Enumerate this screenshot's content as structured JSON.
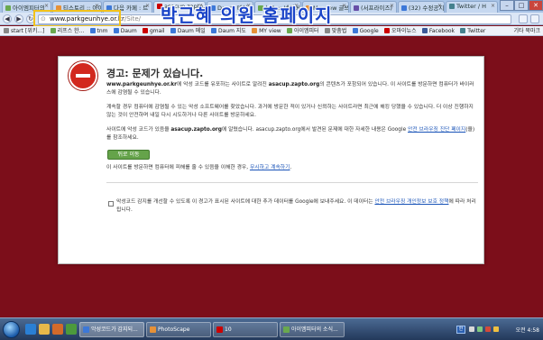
{
  "tabs": [
    {
      "label": "아이엠피터의",
      "color": "#6aa84f",
      "active": false
    },
    {
      "label": "티스토리 :: 아이",
      "color": "#e69138",
      "active": false
    },
    {
      "label": "다음 카페 : 트",
      "color": "#3c78d8",
      "active": false
    },
    {
      "label": "asacup.zapto.",
      "color": "#cc0000",
      "active": true
    },
    {
      "label": "Daum 메일",
      "color": "#3c78d8",
      "active": false
    },
    {
      "label": "뉴스 :: 네이버",
      "color": "#6aa84f",
      "active": false
    },
    {
      "label": "My view 글쓰",
      "color": "#e69138",
      "active": false
    },
    {
      "label": "(서프라이즈)",
      "color": "#674ea7",
      "active": false
    },
    {
      "label": "(32) 수정공지",
      "color": "#3c78d8",
      "active": false
    },
    {
      "label": "Twitter / H",
      "color": "#45818e",
      "active": false
    }
  ],
  "window_controls": {
    "minimize": "–",
    "maximize": "□",
    "close": "✕"
  },
  "toolbar": {
    "back": "◀",
    "forward": "▶",
    "reload": "↻",
    "url_host": "www.parkgeunhye.or.kr",
    "url_path": "/Site/",
    "lock_icon": "🔒"
  },
  "overlay_title": "박근혜 의원 홈페이지",
  "bookmarks": [
    {
      "label": "start [위키...]",
      "color": "#888888"
    },
    {
      "label": "리프스 한...",
      "color": "#6aa84f"
    },
    {
      "label": "tnm",
      "color": "#3c78d8"
    },
    {
      "label": "Daum",
      "color": "#3c78d8"
    },
    {
      "label": "gmail",
      "color": "#cc0000"
    },
    {
      "label": "Daum 메일",
      "color": "#3c78d8"
    },
    {
      "label": "Daum 지도",
      "color": "#3c78d8"
    },
    {
      "label": "MY view",
      "color": "#e69138"
    },
    {
      "label": "아이엠피터",
      "color": "#6aa84f"
    },
    {
      "label": "맞춤법",
      "color": "#888888"
    },
    {
      "label": "Google",
      "color": "#3c78d8"
    },
    {
      "label": "오마이뉴스",
      "color": "#cc0000"
    },
    {
      "label": "Facebook",
      "color": "#3b5998"
    },
    {
      "label": "Twitter",
      "color": "#45818e"
    }
  ],
  "other_bookmarks": "기타 북마크",
  "warning": {
    "title": "경고: 문제가 있습니다.",
    "p1_bold_site": "www.parkgeunhye.or.kr",
    "p1_a": "에 악성 코드를 유포하는 사이트로 알려진 ",
    "p1_bold_source": "asacup.zapto.org",
    "p1_b": "의 콘텐츠가 포함되어 있습니다. 이 사이트를 방문하면 컴퓨터가 바이러스에 감염될 수 있습니다.",
    "p2": "계속할 경우 컴퓨터에 감염될 수 있는 악성 소프트웨어를 찾았습니다. 과거에 방문한 적이 있거나 신뢰하는 사이트라면 최근에 해킹 당했을 수 있습니다. 더 이상 진행하지 않는 것이 안전하며 내일 다시 시도하거나 다른 사이트를 방문하세요.",
    "p3_a": "사이트에 악성 코드가 있음을 ",
    "p3_bold": "asacup.zapto.org",
    "p3_b": "에 알렸습니다. asacup.zapto.org에서 발견된 문제에 대한 자세한 내용은 Google ",
    "p3_link": "안전 브라우징 진단 페이지",
    "p3_c": "(을)를 참조하세요.",
    "back_button": "뒤로 이동",
    "p4_a": "이 사이트를 방문하면 컴퓨터에 피해를 줄 수 있음을 이해한 경우, ",
    "p4_link": "무시하고 계속하기",
    "p4_b": ".",
    "p5_a": "악성코드 감지를 개선할 수 있도록 이 경고가 표시된 사이트에 대한 추가 데이터를 Google에 보내주세요. 이 데이터는 ",
    "p5_link": "안전 브라우징 개인정보 보호 정책",
    "p5_b": "에 따라 처리됩니다."
  },
  "taskbar": {
    "tasks": [
      {
        "label": "악성코드가 감지되...",
        "color": "#3c78d8",
        "active": true
      },
      {
        "label": "PhotoScape",
        "color": "#e69138",
        "active": false
      },
      {
        "label": "10",
        "color": "#cc0000",
        "active": false
      },
      {
        "label": "아이엠피터의 소식...",
        "color": "#6aa84f",
        "active": false
      }
    ],
    "ime": "한",
    "clock": "오전 4:58"
  },
  "colors": {
    "page_bg": "#7c0e1a",
    "accent_green": "#65a34a",
    "stop_red": "#d2281e",
    "overlay_blue": "#1a44c8",
    "highlight_yellow": "#f2c21b"
  }
}
